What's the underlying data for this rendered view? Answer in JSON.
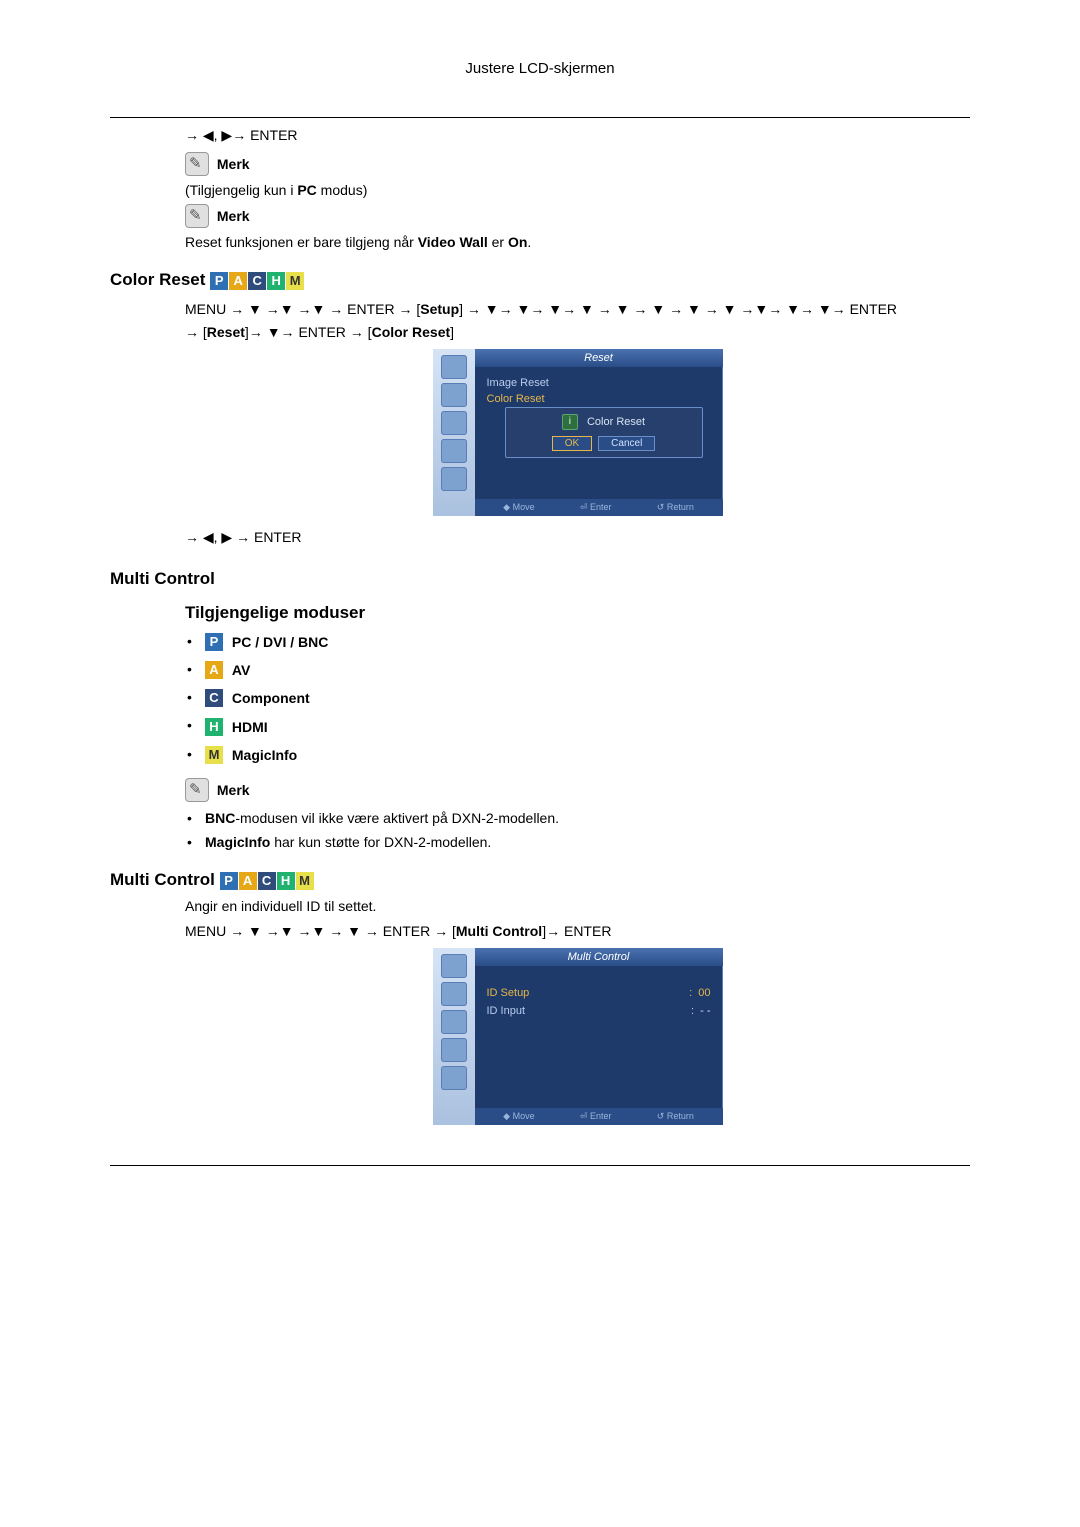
{
  "header": {
    "title": "Justere LCD-skjermen"
  },
  "intro": {
    "nav1": "→ ◀, ▶→ ENTER",
    "note_label": "Merk",
    "note1_pre": "(Tilgjengelig kun i ",
    "note1_bold": "PC",
    "note1_post": " modus)",
    "note2_pre": "Reset funksjonen er bare tilgjeng når ",
    "note2_bold1": "Video Wall",
    "note2_mid": " er ",
    "note2_bold2": "On",
    "note2_end": "."
  },
  "color_reset": {
    "heading": "Color Reset",
    "badges": [
      "P",
      "A",
      "C",
      "H",
      "M"
    ],
    "nav_line1_pre": "MENU → ▼ →▼ →▼ → ENTER → [",
    "nav_line1_setup": "Setup",
    "nav_line1_post": "] → ▼→ ▼→ ▼→ ▼ → ▼ → ▼ → ▼ → ▼ →▼→ ▼→ ▼→ ENTER",
    "nav_line2_pre": "→ [",
    "nav_line2_reset": "Reset",
    "nav_line2_mid": "]→ ▼→ ENTER → [",
    "nav_line2_cr": "Color Reset",
    "nav_line2_post": "]",
    "osd": {
      "title": "Reset",
      "items": [
        "Image Reset",
        "Color Reset"
      ],
      "dialog_title": "Color Reset",
      "ok": "OK",
      "cancel": "Cancel",
      "footer": [
        "◆ Move",
        "⏎ Enter",
        "↺ Return"
      ]
    },
    "nav_after": "→ ◀, ▶ → ENTER"
  },
  "multi_control": {
    "heading": "Multi Control",
    "sub_heading": "Tilgjengelige moduser",
    "modes": [
      {
        "badge": "P",
        "label": "PC / DVI / BNC"
      },
      {
        "badge": "A",
        "label": "AV"
      },
      {
        "badge": "C",
        "label": "Component"
      },
      {
        "badge": "H",
        "label": "HDMI"
      },
      {
        "badge": "M",
        "label": "MagicInfo"
      }
    ],
    "note_label": "Merk",
    "notes": [
      {
        "b1": "BNC",
        "rest": "-modusen vil ikke være aktivert på DXN-2-modellen."
      },
      {
        "b1": "MagicInfo",
        "rest": " har kun støtte for DXN-2-modellen."
      }
    ]
  },
  "multi_control2": {
    "heading": "Multi Control",
    "badges": [
      "P",
      "A",
      "C",
      "H",
      "M"
    ],
    "desc": "Angir en individuell ID til settet.",
    "nav_pre": "MENU → ▼ →▼ →▼ → ▼ → ENTER → [",
    "nav_mc": "Multi Control",
    "nav_post": "]→ ENTER",
    "osd": {
      "title": "Multi Control",
      "rows": [
        {
          "label": "ID Setup",
          "value": "00",
          "sel": true
        },
        {
          "label": "ID Input",
          "value": "- -",
          "sel": false
        }
      ],
      "footer": [
        "◆ Move",
        "⏎ Enter",
        "↺ Return"
      ]
    }
  }
}
